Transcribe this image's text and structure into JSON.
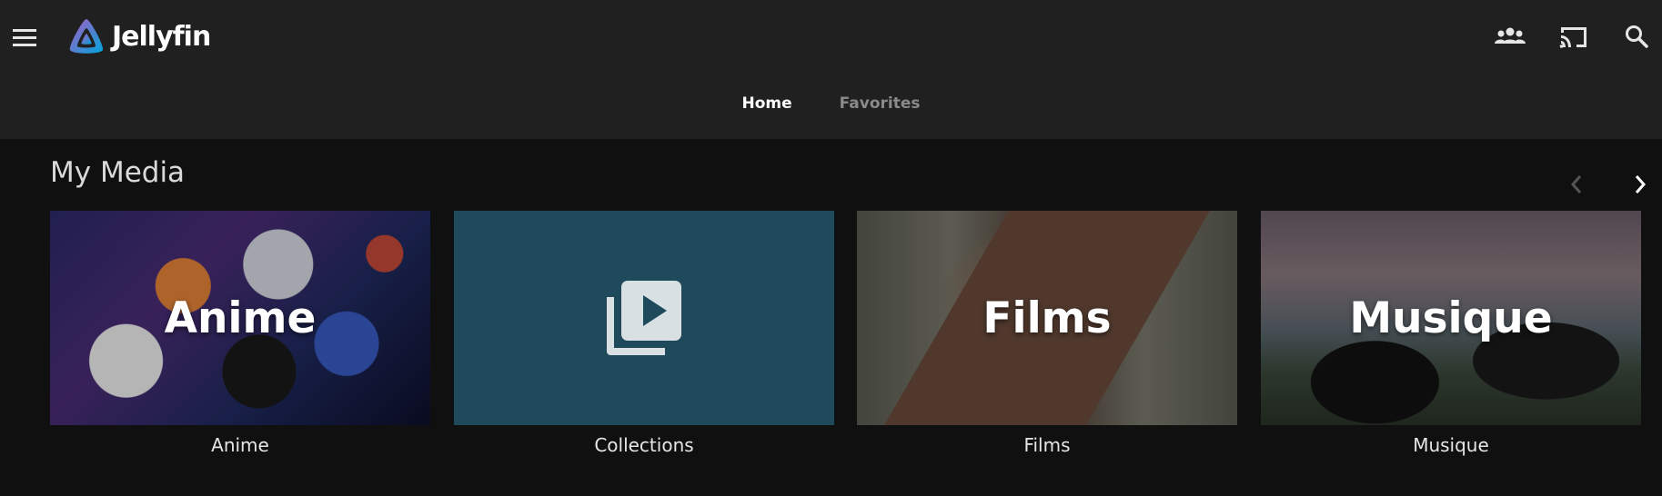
{
  "app": {
    "name": "Jellyfin",
    "accent_colors": [
      "#aa5cc3",
      "#00a4dc"
    ]
  },
  "header": {
    "icons": [
      "menu-icon",
      "users-icon",
      "cast-icon",
      "search-icon"
    ]
  },
  "tabs": [
    {
      "label": "Home",
      "active": true
    },
    {
      "label": "Favorites",
      "active": false
    }
  ],
  "section": {
    "title": "My Media"
  },
  "cards": [
    {
      "overlay": "Anime",
      "label": "Anime"
    },
    {
      "overlay": "",
      "label": "Collections",
      "icon": "video-library-icon"
    },
    {
      "overlay": "Films",
      "label": "Films"
    },
    {
      "overlay": "Musique",
      "label": "Musique"
    }
  ]
}
